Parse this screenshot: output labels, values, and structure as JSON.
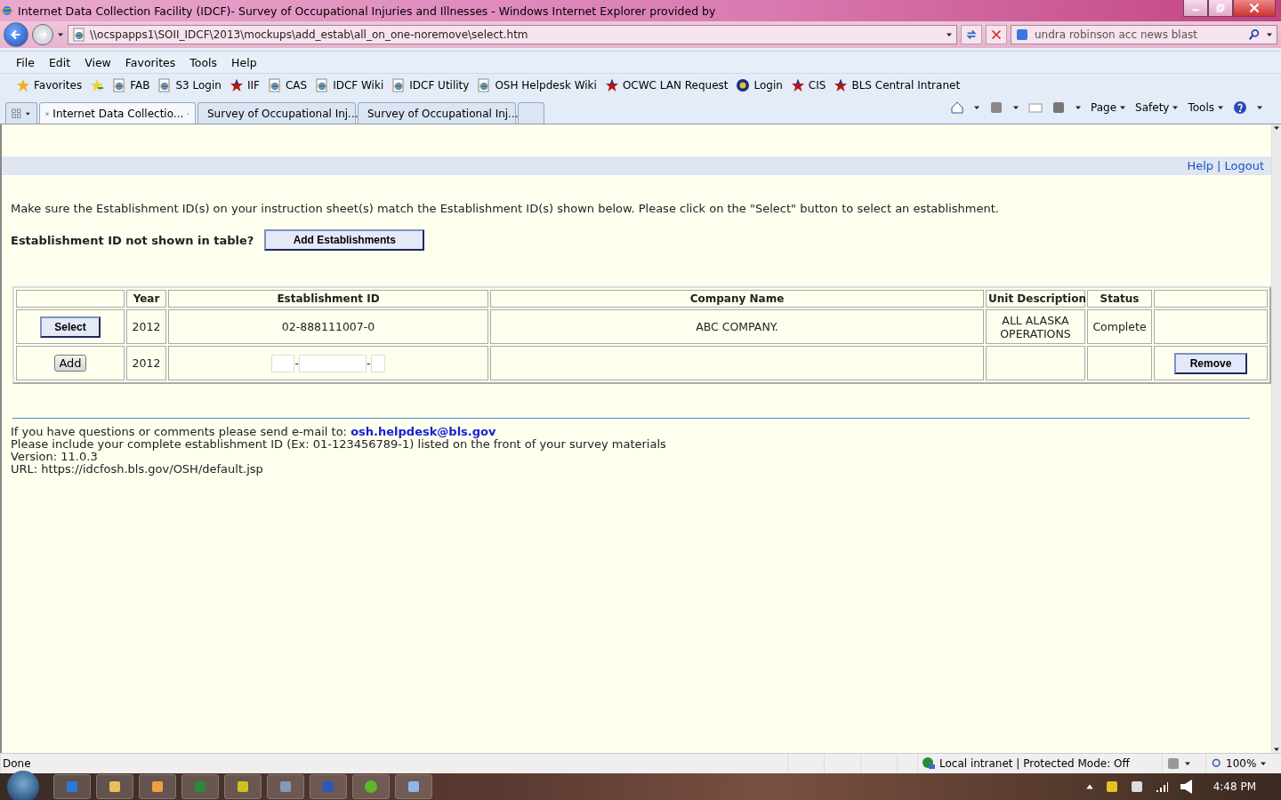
{
  "window": {
    "title": "Internet Data Collection Facility (IDCF)- Survey of Occupational Injuries and Illnesses - Windows Internet Explorer provided by"
  },
  "address": {
    "url": "\\\\ocspapps1\\SOII_IDCF\\2013\\mockups\\add_estab\\all_on_one-noremove\\select.htm"
  },
  "search": {
    "value": "undra robinson acc news blast"
  },
  "menu": [
    "File",
    "Edit",
    "View",
    "Favorites",
    "Tools",
    "Help"
  ],
  "favorites_bar": {
    "label": "Favorites",
    "items": [
      {
        "label": "FAB",
        "kind": "page"
      },
      {
        "label": "S3 Login",
        "kind": "page"
      },
      {
        "label": "IIF",
        "kind": "star"
      },
      {
        "label": "CAS",
        "kind": "page"
      },
      {
        "label": "IDCF Wiki",
        "kind": "page"
      },
      {
        "label": "IDCF Utility",
        "kind": "page"
      },
      {
        "label": "OSH Helpdesk Wiki",
        "kind": "page"
      },
      {
        "label": "OCWC LAN Request",
        "kind": "star"
      },
      {
        "label": "Login",
        "kind": "seal"
      },
      {
        "label": "CIS",
        "kind": "star"
      },
      {
        "label": "BLS Central Intranet",
        "kind": "star"
      }
    ]
  },
  "tabs": [
    {
      "label": "Internet Data Collectio...",
      "selected": true
    },
    {
      "label": "Survey of Occupational Inj...",
      "selected": false
    },
    {
      "label": "Survey of Occupational Inj...",
      "selected": false
    }
  ],
  "command_bar": [
    "Page",
    "Safety",
    "Tools"
  ],
  "page": {
    "header_links": [
      "Help",
      "Logout"
    ],
    "header_separator": "|",
    "instruction": "Make sure the Establishment ID(s) on your instruction sheet(s) match the Establishment ID(s) shown below. Please click on the \"Select\" button to select an establishment.",
    "missing_prompt": "Establishment ID not shown in table?",
    "add_establishments_button": "Add Establishments",
    "table": {
      "columns": [
        "Year",
        "Establishment ID",
        "Company Name",
        "Unit Description",
        "Status"
      ],
      "rows": [
        {
          "kind": "existing",
          "action": "Select",
          "year": "2012",
          "establishment_id": "02-888111007-0",
          "company_name": "ABC COMPANY.",
          "unit_description": "ALL ALASKA OPERATIONS",
          "status": "Complete"
        },
        {
          "kind": "new",
          "action": "Add",
          "year": "2012",
          "separators": [
            "-",
            "-"
          ],
          "remove": "Remove"
        }
      ]
    },
    "footer": {
      "contact": "If you have questions or comments please send e-mail to:",
      "email": "osh.helpdesk@bls.gov",
      "lines": [
        "Please include your complete establishment ID (Ex: 01-123456789-1) listed on the front of your survey materials",
        "Version: 11.0.3",
        "URL: https://idcfosh.bls.gov/OSH/default.jsp"
      ]
    }
  },
  "status_bar": {
    "text": "Done",
    "zone": "Local intranet | Protected Mode: Off",
    "zoom": "100%"
  },
  "taskbar": {
    "time": "4:48 PM"
  }
}
